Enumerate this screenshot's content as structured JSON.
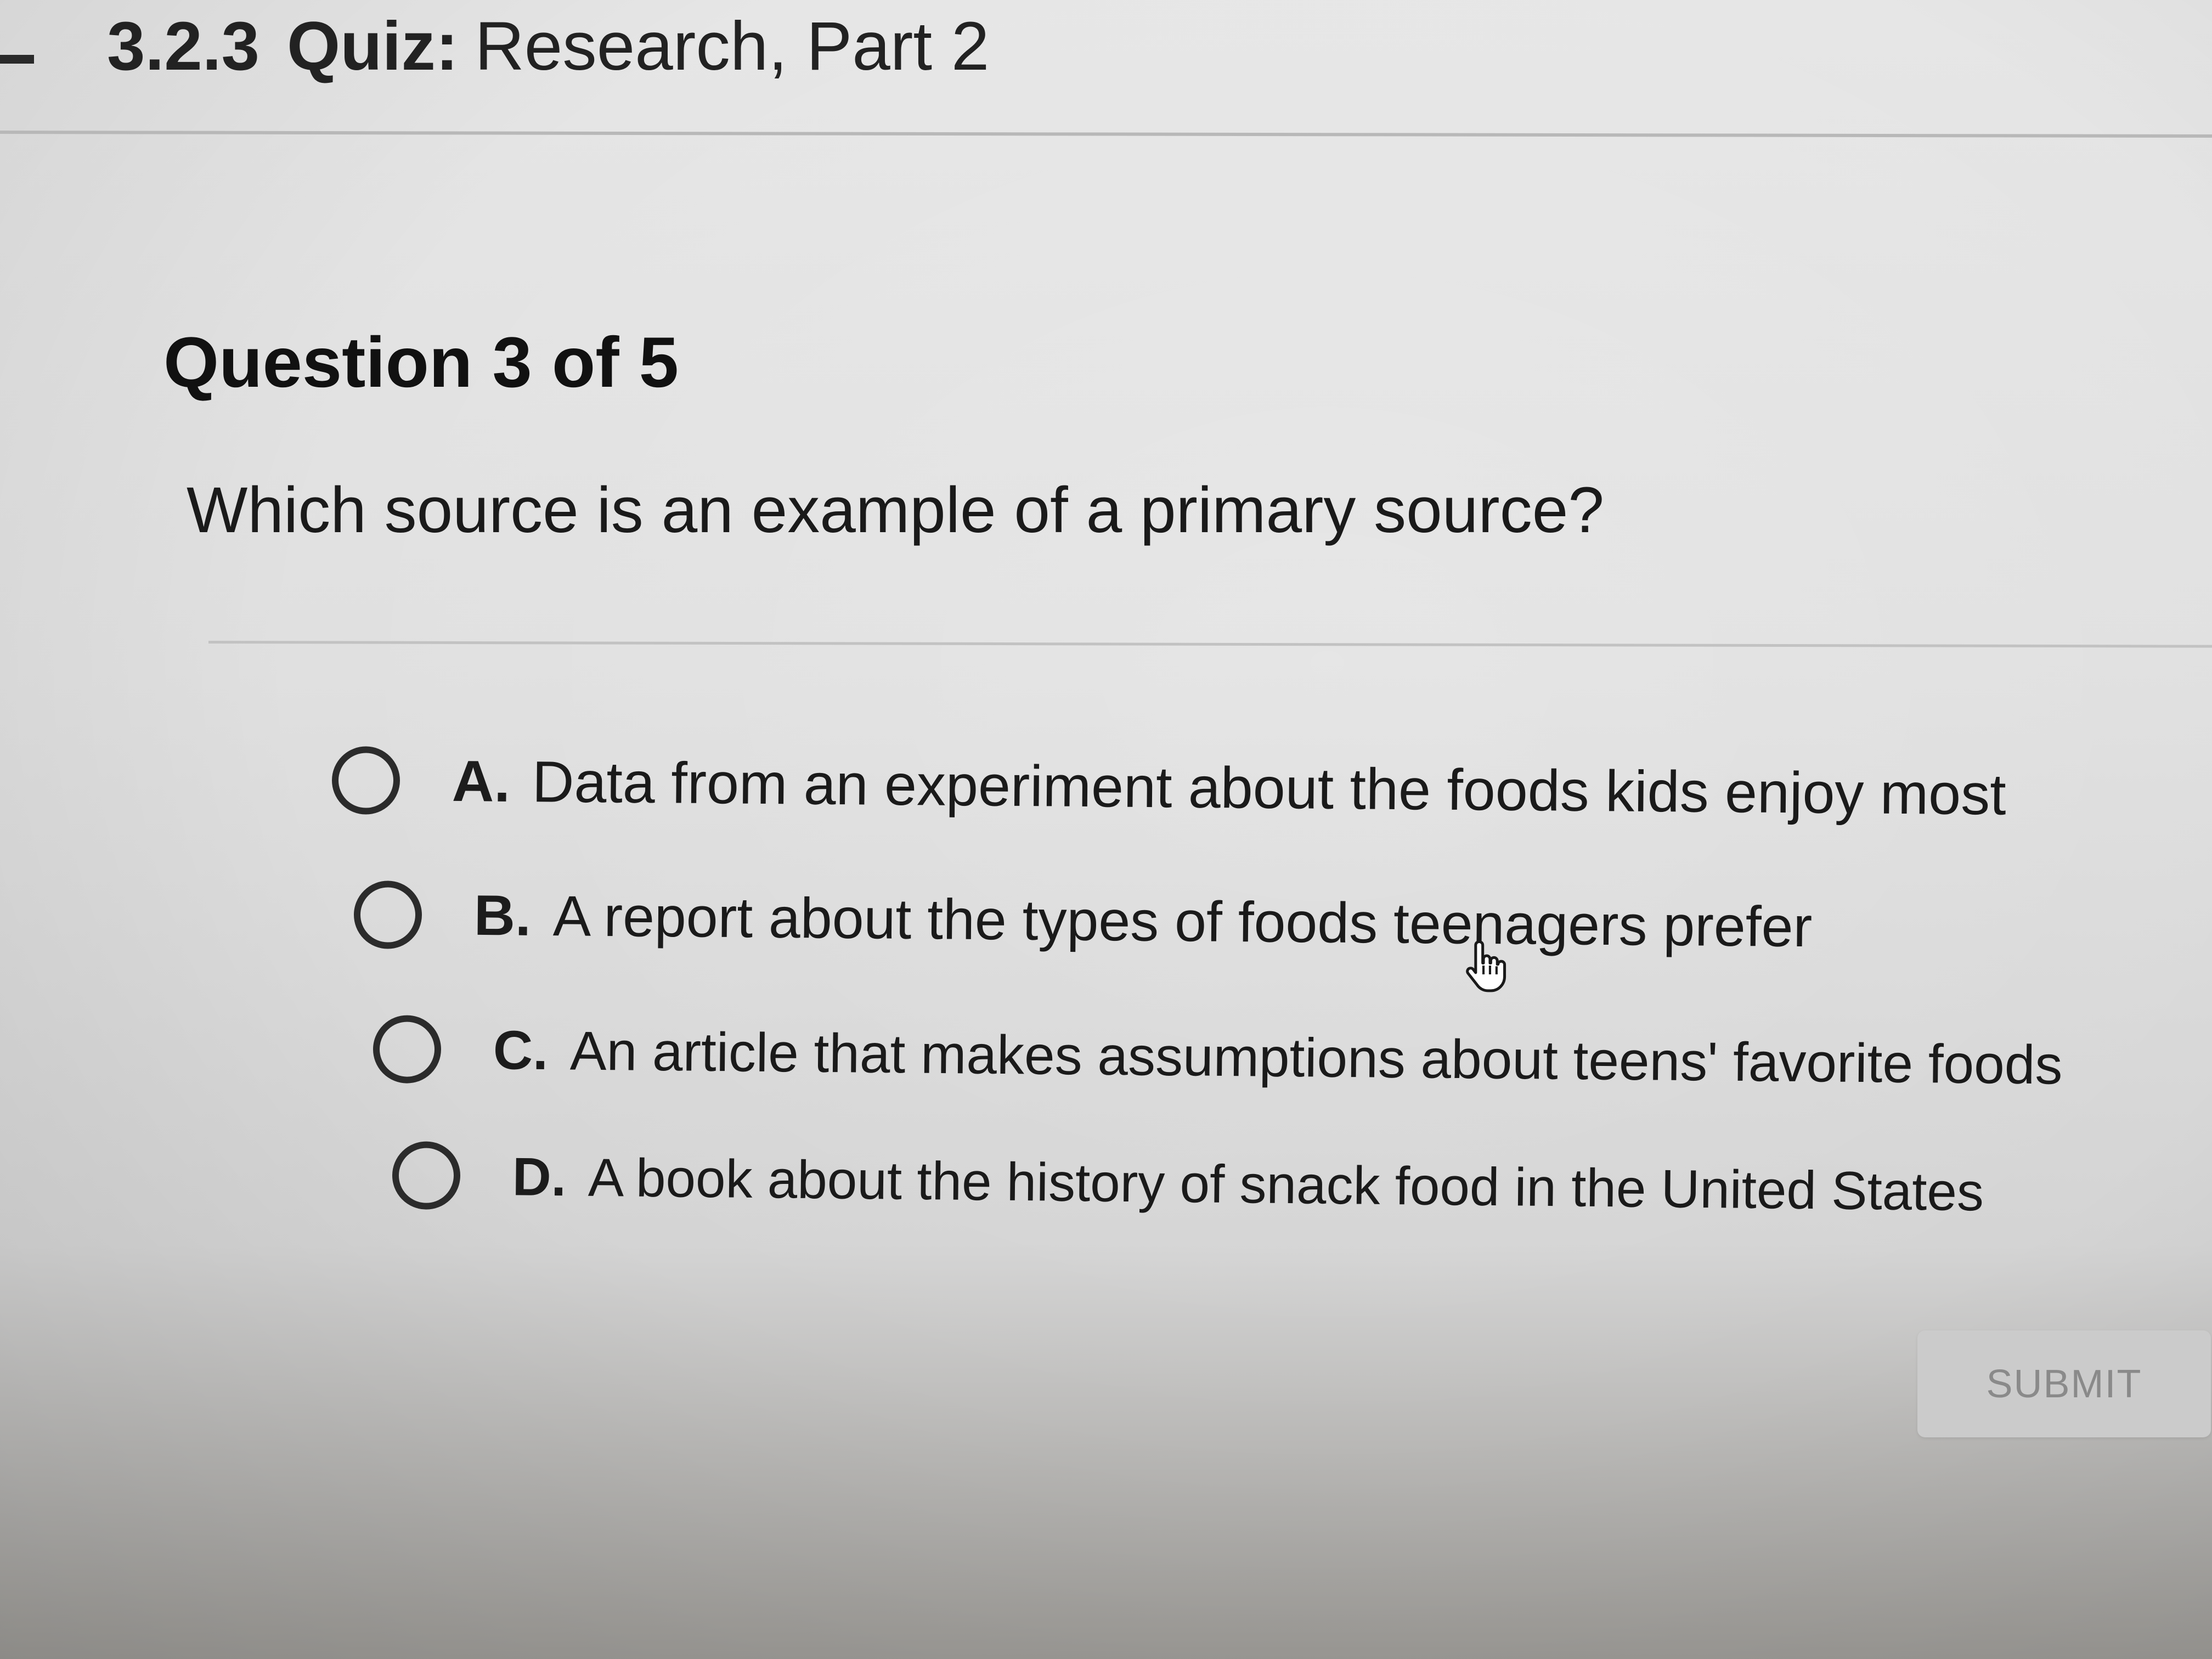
{
  "header": {
    "quiz_number": "3.2.3",
    "quiz_label": "Quiz:",
    "quiz_title": "Research, Part 2"
  },
  "question": {
    "counter": "Question 3 of 5",
    "prompt": "Which source is an example of a primary source?"
  },
  "options": [
    {
      "letter": "A.",
      "text": "Data from an experiment about the foods kids enjoy most",
      "selected": false
    },
    {
      "letter": "B.",
      "text": "A report about the types of foods teenagers prefer",
      "selected": false
    },
    {
      "letter": "C.",
      "text": "An article that makes assumptions about teens' favorite foods",
      "selected": false
    },
    {
      "letter": "D.",
      "text": "A book about the history of snack food in the United States",
      "selected": false
    }
  ],
  "submit": {
    "label": "SUBMIT",
    "enabled": false
  },
  "cursor": {
    "icon": "hand-pointer-icon"
  },
  "colors": {
    "background": "#e0e0e0",
    "text": "#1a1a1a",
    "submit_bg": "#cbcbcb",
    "submit_text": "#8a8a8a"
  }
}
